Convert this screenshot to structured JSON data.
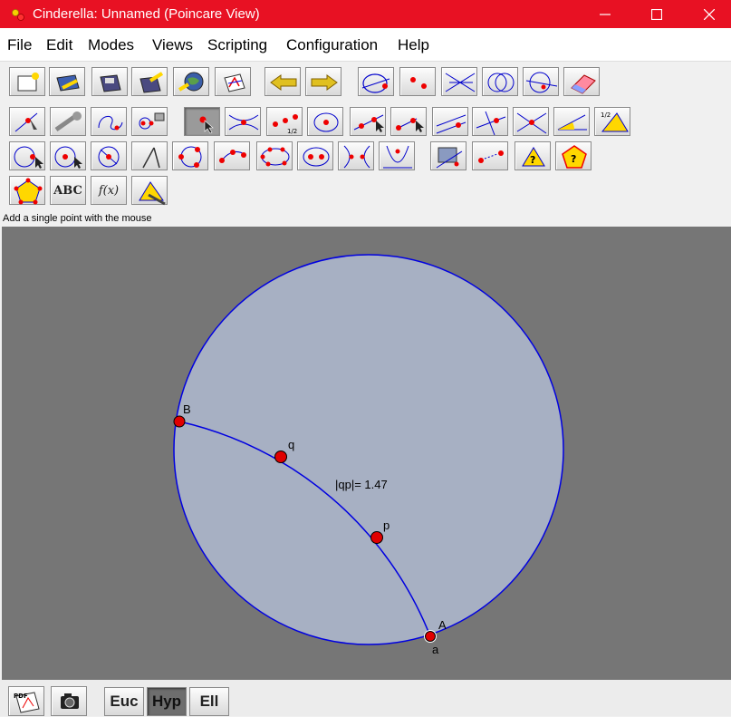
{
  "window": {
    "title": "Cinderella: Unnamed (Poincare View)",
    "minimize_glyph": "—",
    "close_glyph": "✕"
  },
  "menu": [
    "File",
    "Edit",
    "Modes",
    "Views",
    "Scripting",
    "Configuration",
    "Help"
  ],
  "toolbar": {
    "text_tool_label": "ABC",
    "function_tool_label": "f(x)",
    "selected_tool": "add-point-tool"
  },
  "status_text": "Add a single point with the mouse",
  "canvas": {
    "points": [
      {
        "label": "B"
      },
      {
        "label": "q"
      },
      {
        "label": "p"
      },
      {
        "label": "A"
      }
    ],
    "segment_label": "a",
    "distance_label": "|qp|= 1.47"
  },
  "bottom": {
    "geometries": [
      "Euc",
      "Hyp",
      "Ell"
    ],
    "active_geometry": "Hyp"
  },
  "colors": {
    "titlebar": "#e81123",
    "canvas_background": "#767676",
    "disk_fill": "#a7b0c3",
    "disk_stroke": "#0000e0",
    "point_fill": "#e00000"
  }
}
